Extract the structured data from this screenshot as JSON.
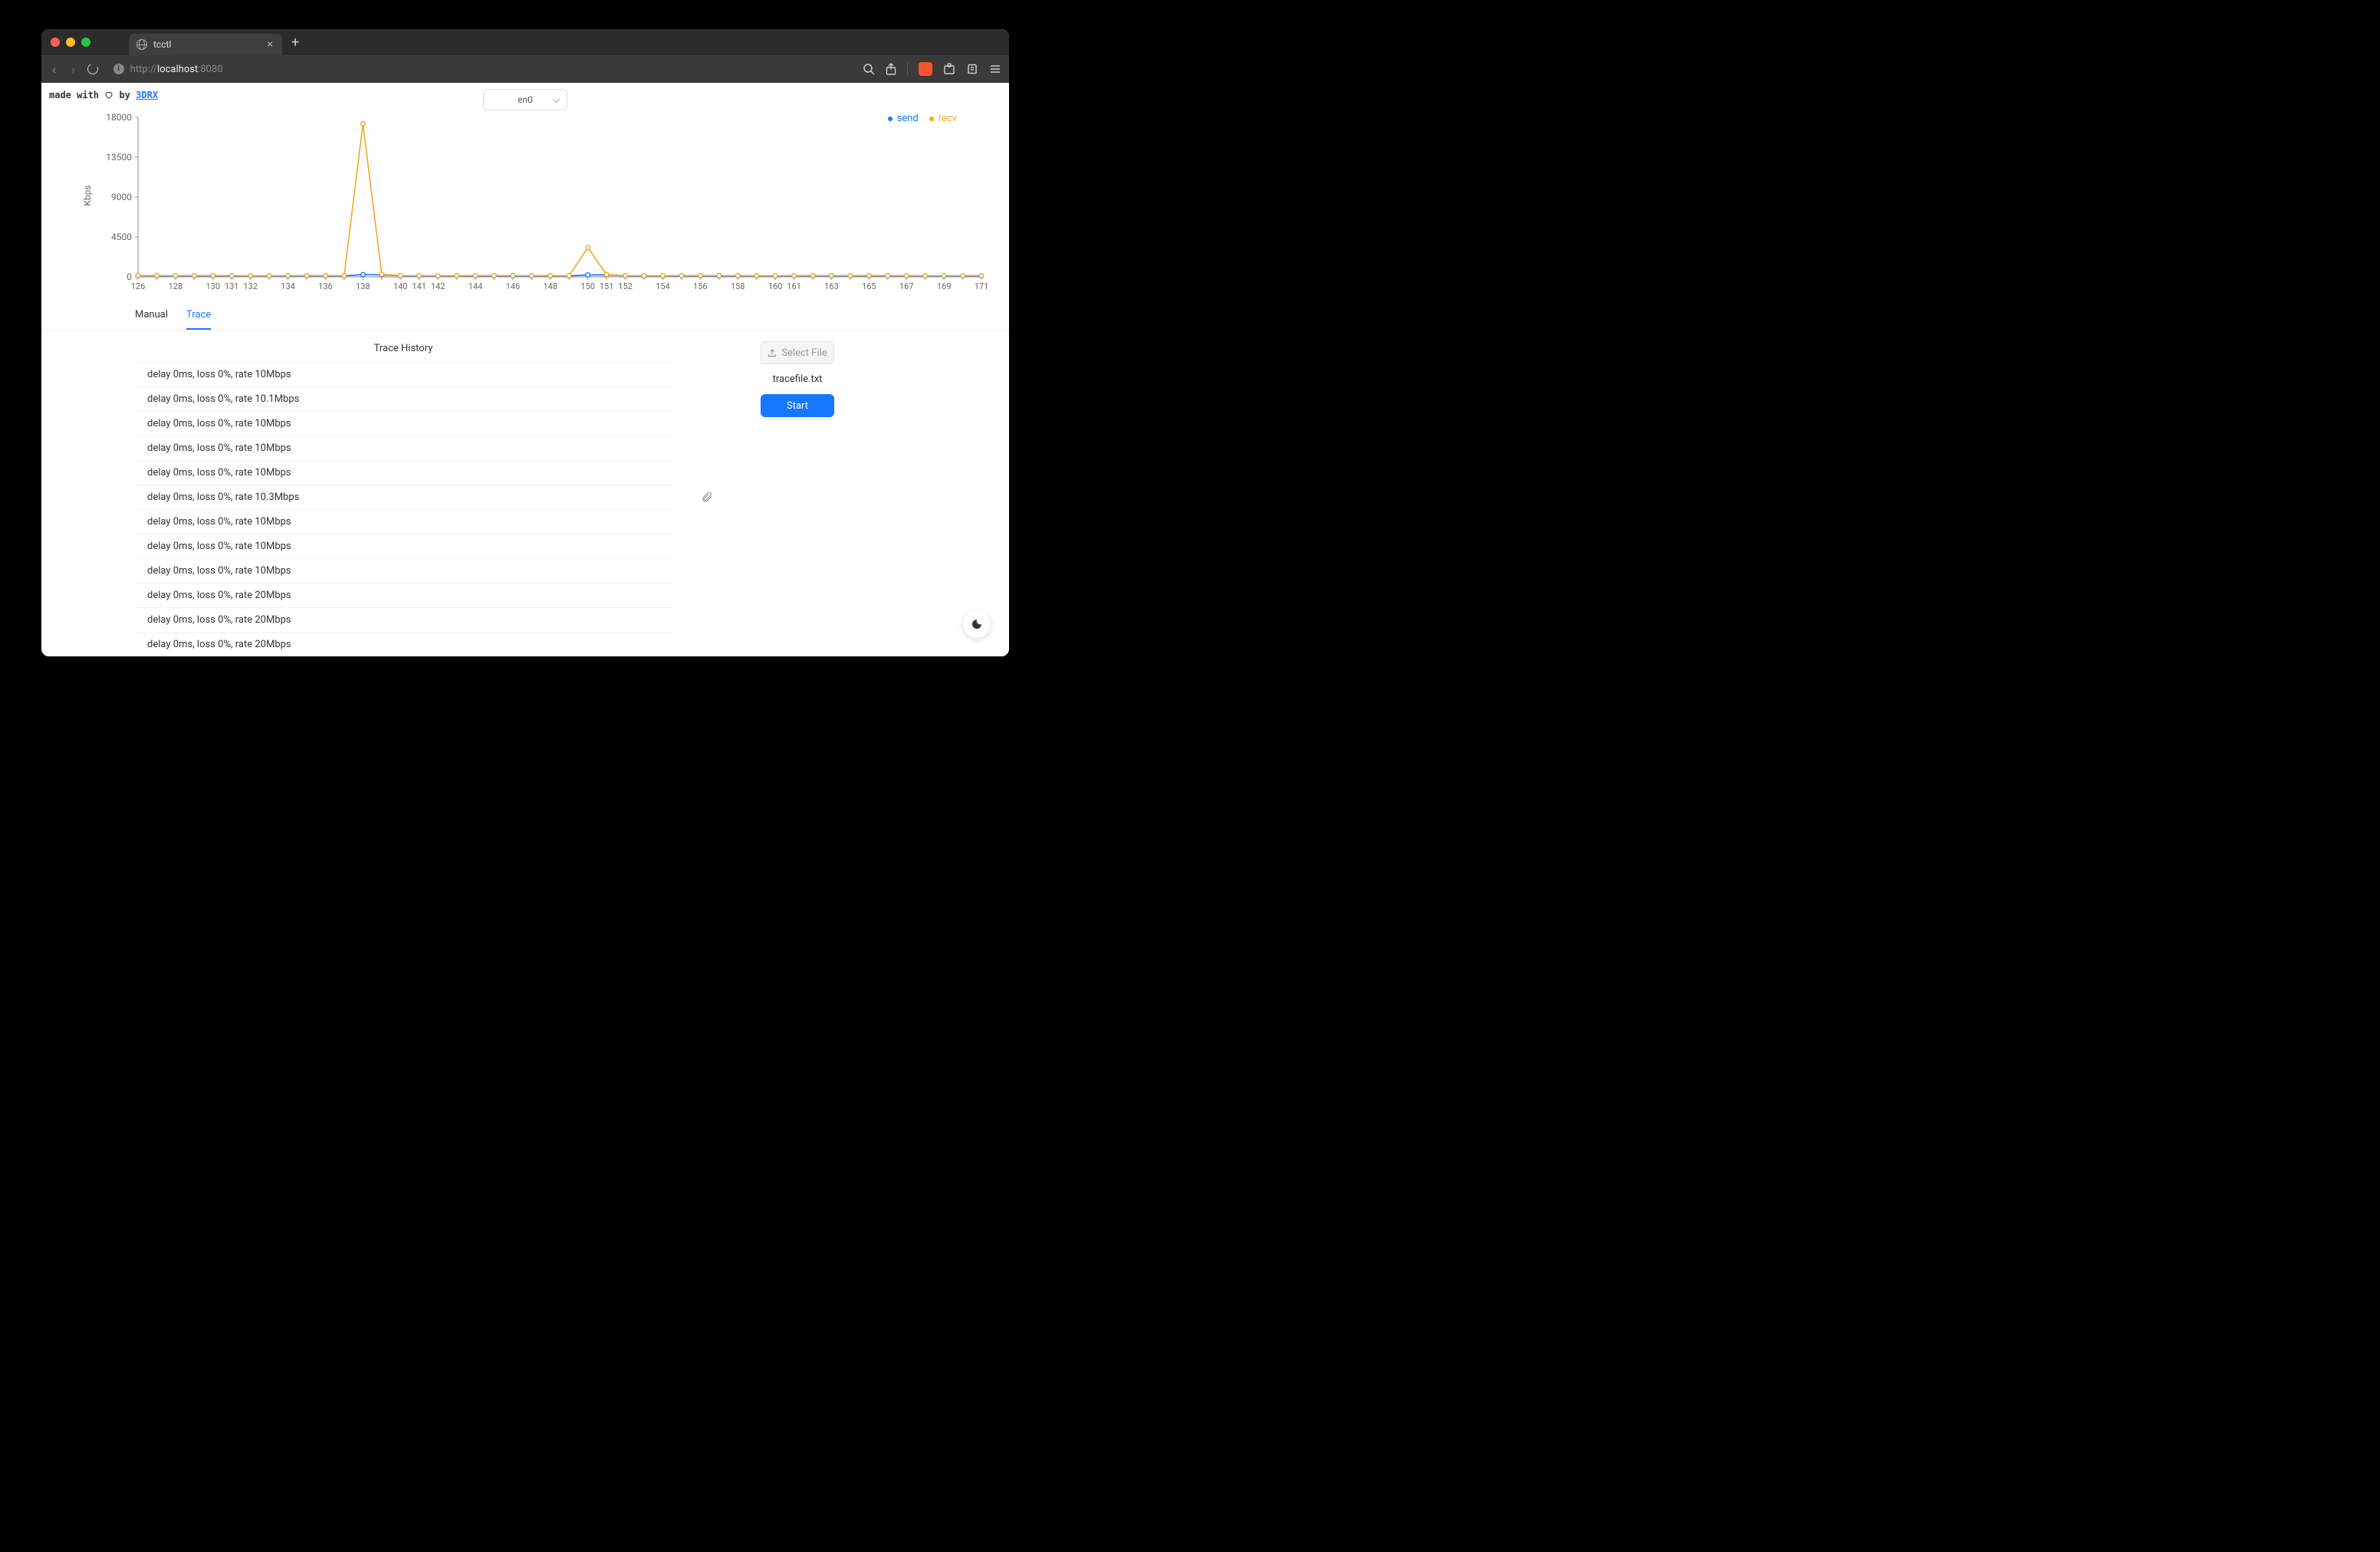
{
  "browser": {
    "tab_title": "tcctl",
    "url_prefix": "http://",
    "url_host": "localhost",
    "url_port": ":8080"
  },
  "credits": {
    "prefix": "made with ",
    "middle": " by ",
    "author": "3DRX"
  },
  "interface_select": {
    "value": "en0"
  },
  "chart_data": {
    "type": "line",
    "ylabel": "Kbps",
    "yticks": [
      0,
      4500,
      9000,
      13500,
      18000
    ],
    "ylim": [
      0,
      18000
    ],
    "x": [
      126,
      127,
      128,
      129,
      130,
      131,
      132,
      133,
      134,
      135,
      136,
      137,
      138,
      139,
      140,
      141,
      142,
      143,
      144,
      145,
      146,
      147,
      148,
      149,
      150,
      151,
      152,
      153,
      154,
      155,
      156,
      157,
      158,
      159,
      160,
      161,
      162,
      163,
      164,
      165,
      166,
      167,
      168,
      169,
      170,
      171
    ],
    "xtick_labels": [
      "126",
      "",
      "128",
      "",
      "130",
      "131",
      "132",
      "",
      "134",
      "",
      "136",
      "",
      "138",
      "",
      "140",
      "141",
      "142",
      "",
      "144",
      "",
      "146",
      "",
      "148",
      "",
      "150",
      "151",
      "152",
      "",
      "154",
      "",
      "156",
      "",
      "158",
      "",
      "160",
      "161",
      "",
      "163",
      "",
      "165",
      "",
      "167",
      "",
      "169",
      "",
      "171"
    ],
    "series": [
      {
        "name": "send",
        "color": "#1677ff",
        "values": [
          130,
          120,
          110,
          115,
          120,
          110,
          100,
          105,
          110,
          120,
          115,
          100,
          250,
          220,
          120,
          110,
          100,
          105,
          110,
          115,
          120,
          110,
          105,
          100,
          220,
          210,
          110,
          105,
          100,
          110,
          115,
          120,
          110,
          105,
          100,
          110,
          115,
          120,
          110,
          115,
          120,
          110,
          105,
          100,
          110,
          115
        ]
      },
      {
        "name": "recv",
        "color": "#f5a623",
        "values": [
          150,
          140,
          130,
          135,
          140,
          130,
          120,
          125,
          130,
          140,
          135,
          120,
          17300,
          280,
          140,
          130,
          120,
          125,
          130,
          135,
          140,
          130,
          125,
          120,
          3300,
          250,
          130,
          125,
          120,
          130,
          135,
          140,
          130,
          125,
          120,
          130,
          135,
          140,
          130,
          135,
          140,
          130,
          125,
          120,
          130,
          135
        ]
      }
    ],
    "legend": {
      "send": "send",
      "recv": "recv"
    }
  },
  "tabs": {
    "manual": "Manual",
    "trace": "Trace",
    "active": "trace"
  },
  "trace": {
    "history_title": "Trace History",
    "items": [
      "delay 0ms, loss 0%, rate 10Mbps",
      "delay 0ms, loss 0%, rate 10.1Mbps",
      "delay 0ms, loss 0%, rate 10Mbps",
      "delay 0ms, loss 0%, rate 10Mbps",
      "delay 0ms, loss 0%, rate 10Mbps",
      "delay 0ms, loss 0%, rate 10.3Mbps",
      "delay 0ms, loss 0%, rate 10Mbps",
      "delay 0ms, loss 0%, rate 10Mbps",
      "delay 0ms, loss 0%, rate 10Mbps",
      "delay 0ms, loss 0%, rate 20Mbps",
      "delay 0ms, loss 0%, rate 20Mbps",
      "delay 0ms, loss 0%, rate 20Mbps"
    ],
    "select_file_label": "Select File",
    "filename": "tracefile.txt",
    "start_label": "Start"
  }
}
